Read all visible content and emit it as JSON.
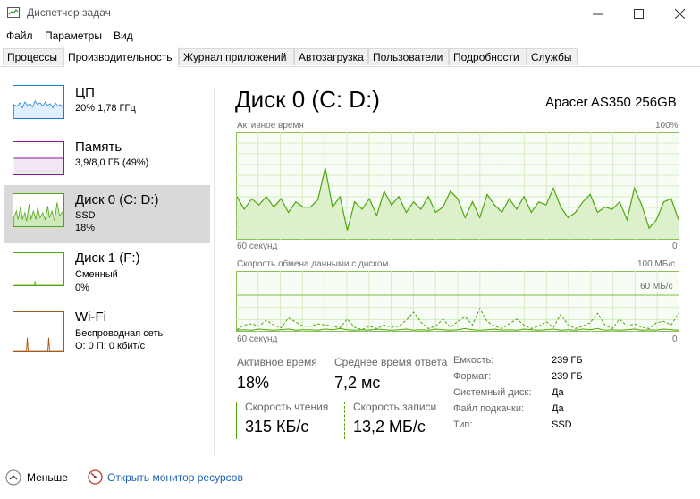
{
  "window": {
    "title": "Диспетчер задач"
  },
  "menu": [
    "Файл",
    "Параметры",
    "Вид"
  ],
  "tabs": [
    "Процессы",
    "Производительность",
    "Журнал приложений",
    "Автозагрузка",
    "Пользователи",
    "Подробности",
    "Службы"
  ],
  "active_tab": 1,
  "sidebar": {
    "items": [
      {
        "name": "ЦП",
        "line1": "20% 1,78 ГГц",
        "line2": "",
        "line3": "",
        "color": "#1a7bd0",
        "icon": "cpu-graph"
      },
      {
        "name": "Память",
        "line1": "3,9/8,0 ГБ (49%)",
        "line2": "",
        "line3": "",
        "color": "#8b1a9b",
        "icon": "memory-graph"
      },
      {
        "name": "Диск 0 (C: D:)",
        "line1": "SSD",
        "line2": "18%",
        "line3": "",
        "color": "#4da60c",
        "icon": "disk-graph"
      },
      {
        "name": "Диск 1 (F:)",
        "line1": "Сменный",
        "line2": "0%",
        "line3": "",
        "color": "#4da60c",
        "icon": "disk-graph"
      },
      {
        "name": "Wi-Fi",
        "line1": "Беспроводная сеть",
        "line2": "О: 0 П: 0 кбит/с",
        "line3": "",
        "color": "#a65b1a",
        "icon": "network-graph"
      }
    ],
    "selected": 2
  },
  "main": {
    "title": "Диск 0 (C: D:)",
    "model": "Apacer AS350 256GB",
    "chart1": {
      "label": "Активное время",
      "max": "100%",
      "xlabel": "60 секунд",
      "min": "0"
    },
    "chart2": {
      "label": "Скорость обмена данными с диском",
      "max": "100 МБ/с",
      "mid": "60 МБ/с",
      "xlabel": "60 секунд",
      "min": "0"
    },
    "stats": {
      "active_time_label": "Активное время",
      "active_time": "18%",
      "avg_response_label": "Среднее время ответа",
      "avg_response": "7,2 мс",
      "read_label": "Скорость чтения",
      "read": "315 КБ/с",
      "write_label": "Скорость записи",
      "write": "13,2 МБ/с"
    },
    "info": [
      {
        "key": "Емкость:",
        "value": "239 ГБ"
      },
      {
        "key": "Формат:",
        "value": "239 ГБ"
      },
      {
        "key": "Системный диск:",
        "value": "Да"
      },
      {
        "key": "Файл подкачки:",
        "value": "Да"
      },
      {
        "key": "Тип:",
        "value": "SSD"
      }
    ]
  },
  "footer": {
    "less": "Меньше",
    "resmon": "Открыть монитор ресурсов"
  },
  "chart_data": [
    {
      "type": "area",
      "title": "Активное время",
      "xlabel": "60 секунд",
      "ylim": [
        0,
        100
      ],
      "x": [
        60,
        59,
        58,
        57,
        56,
        55,
        54,
        53,
        52,
        51,
        50,
        49,
        48,
        47,
        46,
        45,
        44,
        43,
        42,
        41,
        40,
        39,
        38,
        37,
        36,
        35,
        34,
        33,
        32,
        31,
        30,
        29,
        28,
        27,
        26,
        25,
        24,
        23,
        22,
        21,
        20,
        19,
        18,
        17,
        16,
        15,
        14,
        13,
        12,
        11,
        10,
        9,
        8,
        7,
        6,
        5,
        4,
        3,
        2,
        1,
        0
      ],
      "series": [
        {
          "values": [
            40,
            28,
            38,
            32,
            40,
            30,
            38,
            25,
            35,
            30,
            30,
            37,
            67,
            30,
            40,
            8,
            35,
            28,
            38,
            22,
            45,
            32,
            40,
            25,
            35,
            28,
            40,
            25,
            30,
            45,
            38,
            20,
            35,
            20,
            42,
            32,
            25,
            38,
            28,
            40,
            25,
            35,
            32,
            48,
            30,
            20,
            25,
            35,
            42,
            25,
            30,
            28,
            35,
            18,
            48,
            32,
            10,
            18,
            35,
            38,
            18
          ]
        }
      ]
    },
    {
      "type": "line",
      "title": "Скорость обмена данными с диском",
      "xlabel": "60 секунд",
      "ylim": [
        0,
        100
      ],
      "series": [
        {
          "name": "write",
          "values": [
            2,
            10,
            12,
            8,
            18,
            10,
            5,
            22,
            15,
            8,
            8,
            12,
            10,
            8,
            5,
            20,
            6,
            2,
            8,
            4,
            10,
            6,
            8,
            18,
            32,
            15,
            4,
            8,
            20,
            6,
            16,
            24,
            10,
            38,
            16,
            8,
            4,
            12,
            20,
            10,
            4,
            8,
            16,
            6,
            28,
            10,
            4,
            8,
            14,
            30,
            10,
            4,
            20,
            8,
            12,
            6,
            4,
            14,
            16,
            10,
            30
          ]
        },
        {
          "name": "read",
          "values": [
            1,
            2,
            1,
            3,
            2,
            1,
            2,
            3,
            1,
            2,
            2,
            1,
            3,
            2,
            4,
            2,
            1,
            2,
            1,
            3,
            2,
            1,
            2,
            3,
            1,
            2,
            1,
            3,
            2,
            1,
            2,
            4,
            2,
            1,
            2,
            3,
            1,
            2,
            1,
            3,
            2,
            1,
            2,
            3,
            1,
            2,
            1,
            3,
            2,
            4,
            1,
            2,
            1,
            2,
            3,
            1,
            2,
            1,
            3,
            2,
            1
          ]
        }
      ]
    }
  ]
}
